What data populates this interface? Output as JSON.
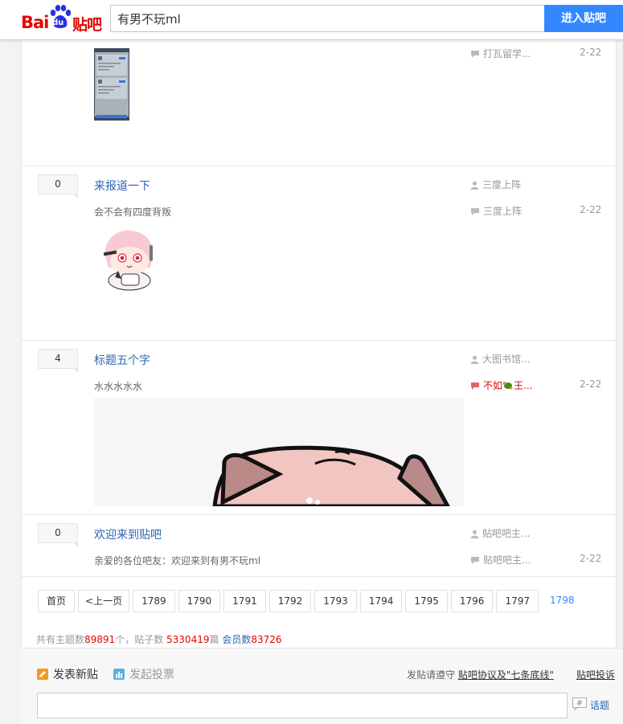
{
  "header": {
    "logo_text_a": "Bai",
    "logo_text_b": "du",
    "logo_text_c": "贴吧",
    "search_value": "有男不玩ml",
    "search_button": "进入贴吧"
  },
  "threads": [
    {
      "replies": "",
      "title": "",
      "abstract": "",
      "author": "",
      "last_replier": "打瓦留学...",
      "date": "2-22"
    },
    {
      "replies": "0",
      "title": "来报道一下",
      "abstract": "会不会有四度背叛",
      "author": "三度上阵",
      "last_replier": "三度上阵",
      "date": "2-22"
    },
    {
      "replies": "4",
      "title": "标题五个字",
      "abstract": "水水水水水",
      "author": "大图书馆...",
      "last_replier_a": "不如",
      "last_replier_b": "王...",
      "date": "2-22"
    },
    {
      "replies": "0",
      "title": "欢迎来到贴吧",
      "abstract": "亲爱的各位吧友：欢迎来到有男不玩ml",
      "author": "贴吧吧主...",
      "last_replier": "贴吧吧主...",
      "date": "2-22"
    }
  ],
  "pagination": {
    "first": "首页",
    "prev": "<上一页",
    "pages": [
      "1789",
      "1790",
      "1791",
      "1792",
      "1793",
      "1794",
      "1795",
      "1796",
      "1797"
    ],
    "current": "1798"
  },
  "stats": {
    "label_topics": "共有主题数",
    "topics": "89891",
    "label_posts": "个，贴子数 ",
    "posts": "5330419",
    "label_members_a": "篇 ",
    "label_members": "会员数",
    "members": "83726"
  },
  "editor": {
    "new_post": "发表新贴",
    "new_vote": "发起投票",
    "rule_prefix": "发贴请遵守 ",
    "rule_link": "贴吧协议及\"七条底线\"",
    "complain": "贴吧投诉",
    "topic": "话题"
  },
  "colors": {
    "accent": "#3388ff",
    "link": "#2d64b3",
    "brand_red": "#e10601"
  }
}
